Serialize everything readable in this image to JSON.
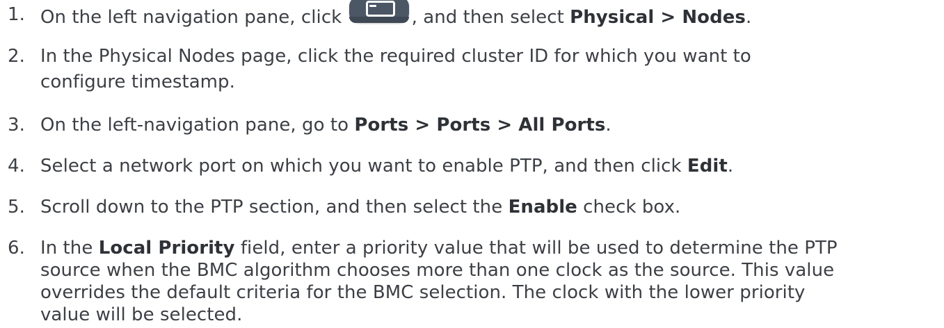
{
  "steps": [
    {
      "number": "1.",
      "before": "On the left navigation pane, click ",
      "icon": "server-icon",
      "middle": ", and then select ",
      "bold": "Physical > Nodes",
      "after": "."
    },
    {
      "number": "2.",
      "line1": "In the Physical Nodes page, click the required cluster ID for which you want to",
      "line2": "configure timestamp."
    },
    {
      "number": "3.",
      "before": "On the left-navigation pane, go to ",
      "bold": "Ports > Ports > All Ports",
      "after": "."
    },
    {
      "number": "4.",
      "before": "Select a network port on which you want to enable PTP, and then click ",
      "bold": "Edit",
      "after": "."
    },
    {
      "number": "5.",
      "before": "Scroll down to the PTP section, and then select the ",
      "bold": "Enable",
      "after": " check box."
    },
    {
      "number": "6.",
      "before": "In the ",
      "bold": "Local Priority",
      "after": " field, enter a priority value that will be used to determine the PTP",
      "line2": "source when the BMC algorithm chooses more than one clock as the source. This value",
      "line3": "overrides the default criteria for the BMC selection. The clock with the lower priority",
      "line4": "value will be selected."
    }
  ]
}
